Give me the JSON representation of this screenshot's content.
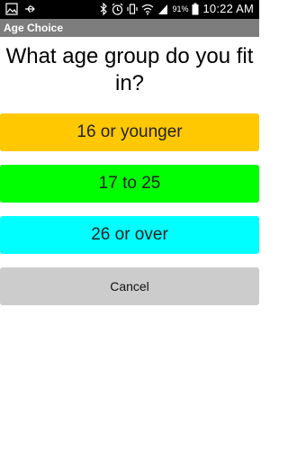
{
  "status_bar": {
    "icons_left": [
      "picture-icon",
      "usb-icon"
    ],
    "icons_right": [
      "bluetooth-icon",
      "alarm-icon",
      "vibrate-icon",
      "wifi-icon",
      "signal-icon"
    ],
    "battery": "91%",
    "time": "10:22 AM"
  },
  "title_bar": {
    "title": "Age Choice"
  },
  "main": {
    "question": "What age group do you fit in?",
    "options": [
      {
        "label": "16 or younger",
        "color": "#ffc800"
      },
      {
        "label": "17 to 25",
        "color": "#00ff00"
      },
      {
        "label": "26 or over",
        "color": "#00ffff"
      }
    ],
    "cancel_label": "Cancel"
  }
}
